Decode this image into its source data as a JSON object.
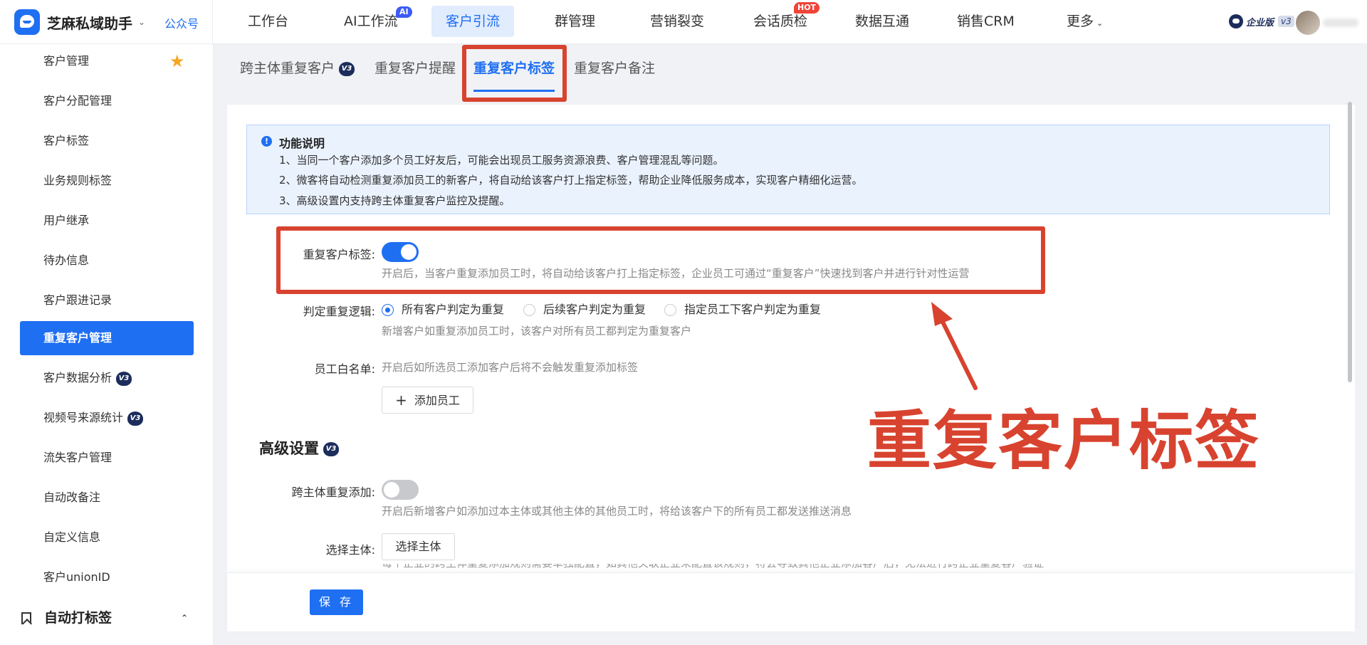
{
  "brand": {
    "name": "芝麻私域助手",
    "link": "公众号"
  },
  "nav": {
    "items": [
      "工作台",
      "AI工作流",
      "客户引流",
      "群管理",
      "营销裂变",
      "会话质检",
      "数据互通",
      "销售CRM",
      "更多"
    ],
    "ai_badge": "AI",
    "hot_badge": "HOT",
    "active_index": 2
  },
  "edition": {
    "label": "企业版",
    "version": "v3"
  },
  "sidebar": {
    "items": [
      "客户管理",
      "客户分配管理",
      "客户标签",
      "业务规则标签",
      "用户继承",
      "待办信息",
      "客户跟进记录",
      "重复客户管理",
      "客户数据分析",
      "视频号来源统计",
      "流失客户管理",
      "自动改备注",
      "自定义信息",
      "客户unionID"
    ],
    "active_index": 7,
    "v3_badge": "V3",
    "group": "自动打标签"
  },
  "tabs": {
    "items": [
      "跨主体重复客户",
      "重复客户提醒",
      "重复客户标签",
      "重复客户备注"
    ],
    "active_index": 2,
    "v3_badge": "V3"
  },
  "info": {
    "title": "功能说明",
    "lines": [
      "1、当同一个客户添加多个员工好友后，可能会出现员工服务资源浪费、客户管理混乱等问题。",
      "2、微客将自动检测重复添加员工的新客户，将自动给该客户打上指定标签，帮助企业降低服务成本，实现客户精细化运营。",
      "3、高级设置内支持跨主体重复客户监控及提醒。"
    ]
  },
  "form": {
    "repeat_tag_label": "重复客户标签:",
    "repeat_tag_help": "开启后，当客户重复添加员工时，将自动给该客户打上指定标签，企业员工可通过“重复客户”快速找到客户并进行针对性运营",
    "repeat_tag_on": true,
    "logic_label": "判定重复逻辑:",
    "logic_options": [
      "所有客户判定为重复",
      "后续客户判定为重复",
      "指定员工下客户判定为重复"
    ],
    "logic_selected": 0,
    "logic_help": "新增客户如重复添加员工时，该客户对所有员工都判定为重复客户",
    "whitelist_label": "员工白名单:",
    "whitelist_help": "开启后如所选员工添加客户后将不会触发重复添加标签",
    "add_staff_button": "添加员工"
  },
  "advanced": {
    "title": "高级设置",
    "v3_badge": "V3",
    "cross_label": "跨主体重复添加:",
    "cross_on": false,
    "cross_help": "开启后新增客户如添加过本主体或其他主体的其他员工时，将给该客户下的所有员工都发送推送消息",
    "entity_label": "选择主体:",
    "entity_button": "选择主体",
    "clipped_help": "每个企业的跨主体重复添加规则需要单独配置，如其他关联企业未配置该规则，将会导致其他企业添加客户后，无法进行跨企业重复客户验证"
  },
  "footer": {
    "save_button": "保 存"
  },
  "annotation": {
    "caption": "重复客户标签",
    "color": "#d8432f"
  },
  "colors": {
    "primary": "#1f6ff2",
    "hot": "#f04438",
    "ai": "#3d5cf5",
    "star": "#f5a623"
  }
}
